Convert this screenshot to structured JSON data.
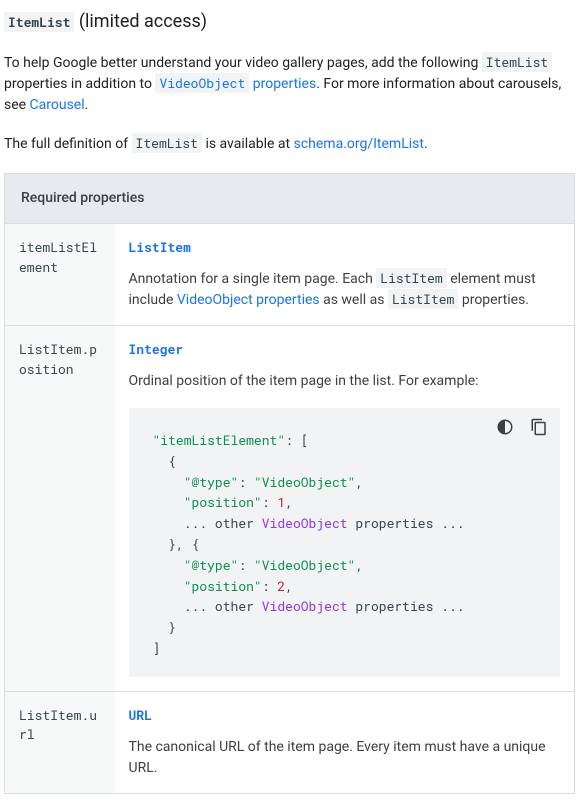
{
  "heading": {
    "code": "ItemList",
    "suffix": " (limited access)"
  },
  "intro": {
    "p1_pre": "To help Google better understand your video gallery pages, add the following ",
    "p1_code1": "ItemList",
    "p1_mid": " properties in addition to ",
    "p1_link1_code": "VideoObject",
    "p1_link1_text": " properties",
    "p1_after1": ". For more information about carousels, see ",
    "p1_link2": "Carousel",
    "p1_end": ".",
    "p2_pre": "The full definition of ",
    "p2_code": "ItemList",
    "p2_mid": " is available at ",
    "p2_link": "schema.org/ItemList",
    "p2_end": "."
  },
  "table": {
    "header": "Required properties",
    "rows": [
      {
        "prop": "itemListElement",
        "type": "ListItem",
        "desc_pre": "Annotation for a single item page. Each ",
        "desc_code1": "ListItem",
        "desc_mid": " element must include ",
        "desc_link": "VideoObject properties",
        "desc_mid2": " as well as ",
        "desc_code2": "ListItem",
        "desc_end": " properties."
      },
      {
        "prop": "ListItem.position",
        "type": "Integer",
        "desc": "Ordinal position of the item page in the list. For example:"
      },
      {
        "prop": "ListItem.url",
        "type": "URL",
        "desc": "The canonical URL of the item page. Every item must have a unique URL."
      }
    ]
  },
  "codeblock": {
    "k_itemListElement": "\"itemListElement\"",
    "k_type": "\"@type\"",
    "v_VideoObject": "\"VideoObject\"",
    "k_position": "\"position\"",
    "v_1": "1",
    "v_2": "2",
    "other_pre": "... other ",
    "other_vo": "VideoObject",
    "other_post": " properties ...",
    "colon_bracket": ": [",
    "brace_open": "  {",
    "colon_space": ": ",
    "comma": ",",
    "brace_close_comma_open": "  }, {",
    "brace_close": "  }",
    "bracket_close": "]"
  }
}
